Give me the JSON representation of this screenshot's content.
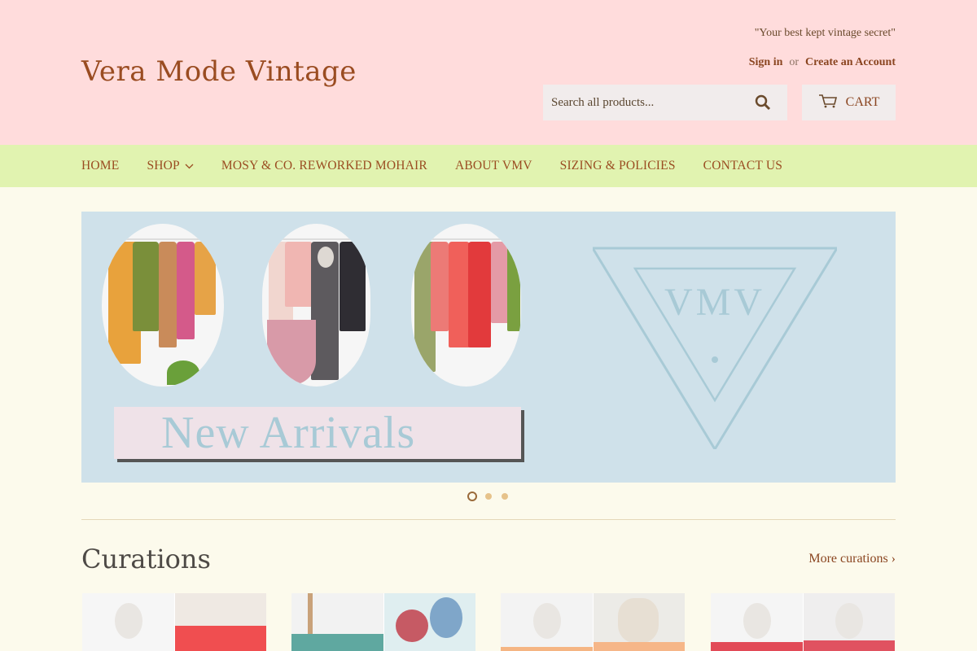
{
  "header": {
    "logo": "Vera Mode Vintage",
    "tagline": "\"Your best kept vintage secret\"",
    "sign_in": "Sign in",
    "or": "or",
    "create_account": "Create an Account",
    "search_placeholder": "Search all products...",
    "cart_label": "CART"
  },
  "nav": {
    "items": [
      {
        "label": "HOME"
      },
      {
        "label": "SHOP",
        "has_dropdown": true
      },
      {
        "label": "MOSY & CO. REWORKED MOHAIR"
      },
      {
        "label": "ABOUT VMV"
      },
      {
        "label": "SIZING & POLICIES"
      },
      {
        "label": "CONTACT US"
      }
    ]
  },
  "hero": {
    "banner_text": "New Arrivals",
    "logo_text": "VMV",
    "slides_count": 3,
    "active_slide": 1
  },
  "curations": {
    "title": "Curations",
    "more_link": "More curations ›"
  },
  "colors": {
    "header_bg": "#ffdcdc",
    "nav_bg": "#e1f3b0",
    "page_bg": "#fcfaec",
    "accent": "#9a4c21"
  }
}
